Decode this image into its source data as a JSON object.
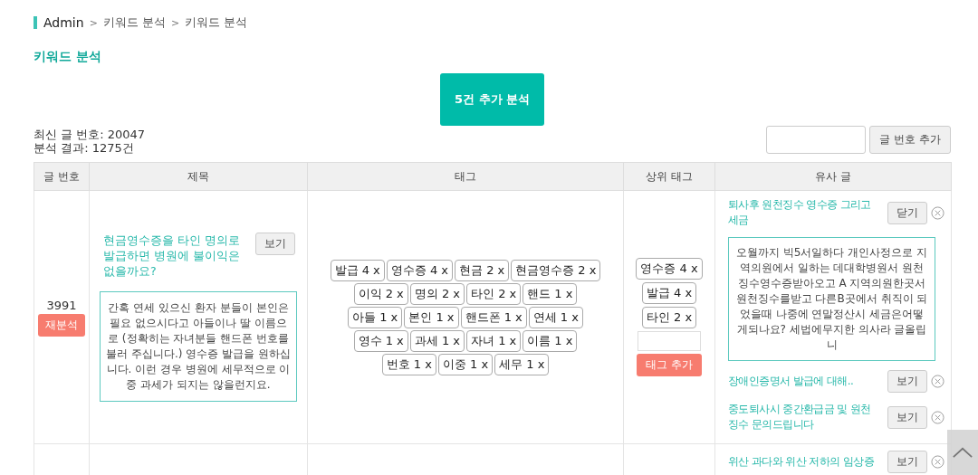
{
  "breadcrumb": [
    {
      "label": "Admin"
    },
    {
      "separator": ">",
      "label": "키워드 분석"
    },
    {
      "separator": ">",
      "label": "키워드 분석"
    }
  ],
  "page_title": "키워드 분석",
  "analyze_button": "5건 추가 분석",
  "stats": [
    "최신 글 번호: 20047",
    "분석 결과: 1275건"
  ],
  "add_post": {
    "button": "글 번호 추가"
  },
  "table": {
    "columns": [
      "글 번호",
      "제목",
      "태그",
      "상위 태그",
      "유사 글"
    ],
    "rows": [
      {
        "number": "3991",
        "reanalyze": "재분석",
        "title": "현금영수증을 타인 명의로 발급하면 병원에 불이익은 없을까요?",
        "view_button": "보기",
        "content": "간혹 연세 있으신 환자 분들이 본인은 필요 없으시다고 아들이나 딸 이름으로 (정확히는 자녀분들 핸드폰 번호를 불러 주십니다.) 영수증 발급을 원하십니다. 이런 경우 병원에 세무적으로 이중 과세가 되지는 않을런지요.",
        "tags": [
          "발급 4 x",
          "영수증 4 x",
          "현금 2 x",
          "현금영수증 2 x",
          "이익 2 x",
          "명의 2 x",
          "타인 2 x",
          "핸드 1 x",
          "아들 1 x",
          "본인 1 x",
          "핸드폰 1 x",
          "연세 1 x",
          "영수 1 x",
          "과세 1 x",
          "자녀 1 x",
          "이름 1 x",
          "번호 1 x",
          "이중 1 x",
          "세무 1 x"
        ],
        "top_tags": [
          "영수증 4 x",
          "발급 4 x",
          "타인 2 x"
        ],
        "add_tag_button": "태그 추가",
        "similar": [
          {
            "title": "퇴사후 원천징수 영수증 그리고 세금",
            "button": "닫기",
            "content": "오월까지 빅5서일하다 개인사정으로 지역의원에서 일하는 데대학병원서 원천징수영수증받아오고 A 지역의원한곳서 원천징수를받고 다른B곳에서 취직이 되었을때 나중에 연말정산시 세금은어떻게되나요? 세법에무지한 의사라 글올립니"
          },
          {
            "title": "장애인증명서 발급에 대해..",
            "button": "보기"
          },
          {
            "title": "중도퇴사시 중간환급금 및 원천징수 문의드립니다",
            "button": "보기"
          }
        ]
      },
      {
        "similar": [
          {
            "title": "위산 과다와 위산 저하의 임상증",
            "button": "보기"
          }
        ]
      }
    ]
  }
}
